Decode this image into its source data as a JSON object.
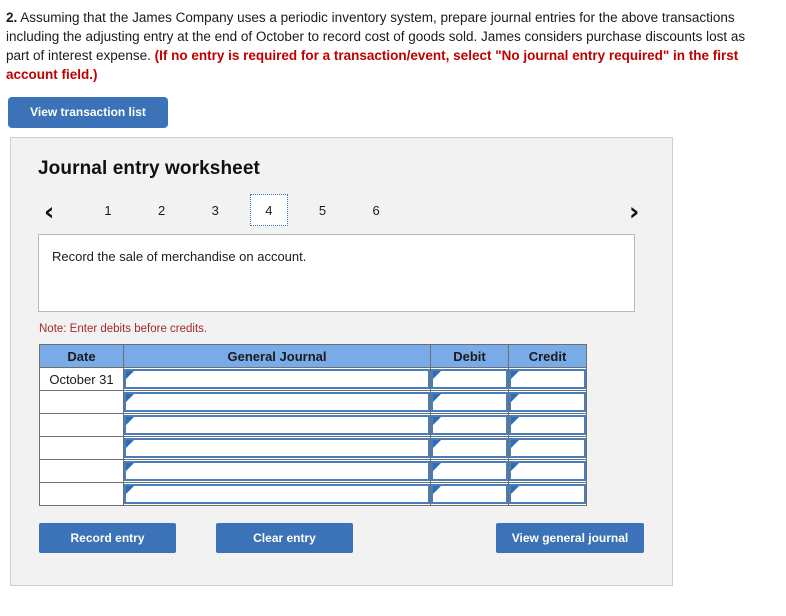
{
  "question": {
    "number": "2.",
    "body": "Assuming that the James Company uses a periodic inventory system, prepare journal entries for the above transactions including the adjusting entry at the end of October to record cost of goods sold. James considers purchase discounts lost as part of interest expense.",
    "emphasis": "(If no entry is required for a transaction/event, select \"No journal entry required\" in the first account field.)"
  },
  "toolbar": {
    "view_transaction_list": "View transaction list"
  },
  "worksheet": {
    "title": "Journal entry worksheet",
    "pager": {
      "prev_icon": "‹",
      "next_icon": "›",
      "tabs": [
        "1",
        "2",
        "3",
        "4",
        "5",
        "6"
      ],
      "active_tab": "4"
    },
    "description": "Record the sale of merchandise on account.",
    "note": "Note: Enter debits before credits.",
    "table": {
      "headers": [
        "Date",
        "General Journal",
        "Debit",
        "Credit"
      ],
      "rows": [
        {
          "date": "October 31",
          "journal": "",
          "debit": "",
          "credit": ""
        },
        {
          "date": "",
          "journal": "",
          "debit": "",
          "credit": ""
        },
        {
          "date": "",
          "journal": "",
          "debit": "",
          "credit": ""
        },
        {
          "date": "",
          "journal": "",
          "debit": "",
          "credit": ""
        },
        {
          "date": "",
          "journal": "",
          "debit": "",
          "credit": ""
        },
        {
          "date": "",
          "journal": "",
          "debit": "",
          "credit": ""
        }
      ]
    },
    "buttons": {
      "record_entry": "Record entry",
      "clear_entry": "Clear entry",
      "view_general_journal": "View general journal"
    }
  },
  "colors": {
    "button_blue": "#3b72b8",
    "header_blue": "#78abe7",
    "input_border_blue": "#4a7ebb",
    "alert_red": "#c00000",
    "note_red": "#a52a2a",
    "panel_bg": "#f2f2f2"
  }
}
